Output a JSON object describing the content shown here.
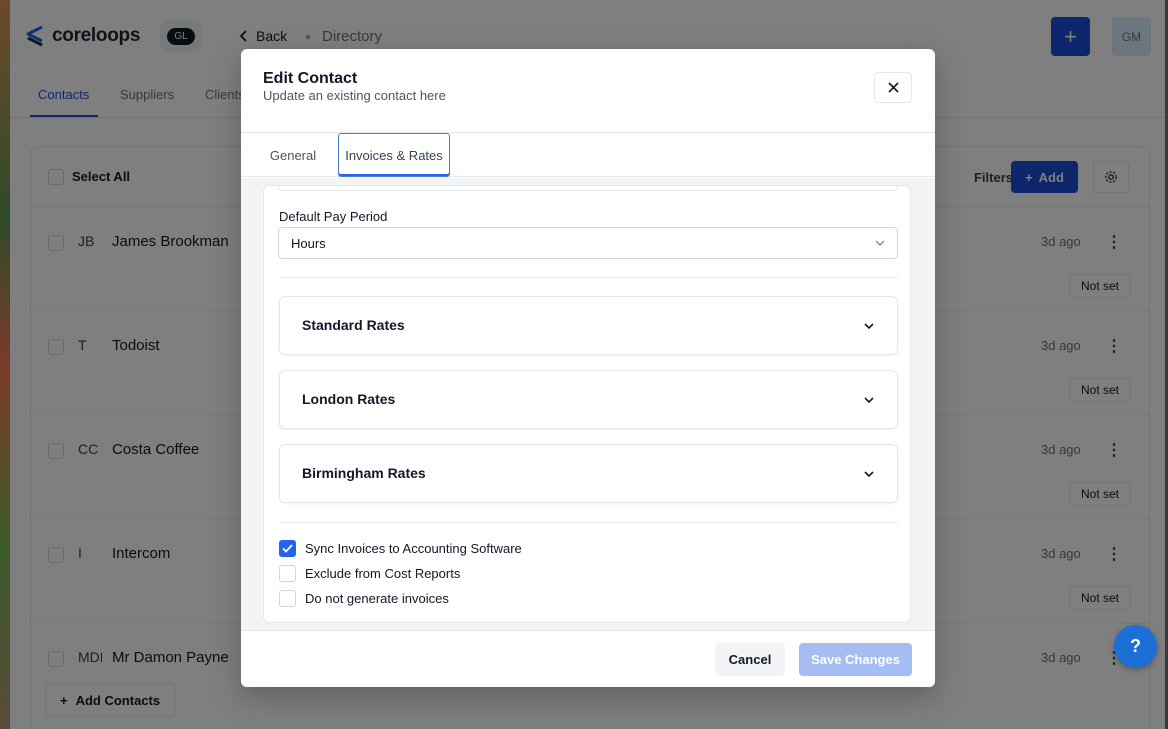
{
  "app": {
    "logo_text": "coreloops",
    "org_badge": "GL",
    "back_label": "Back",
    "breadcrumb": "Directory",
    "header_add_label": "+",
    "user_initials": "GM",
    "accent_color": "#1d4ed8"
  },
  "tabs": [
    "Contacts",
    "Suppliers",
    "Clients"
  ],
  "toolbar": {
    "select_all": "Select All",
    "filters": "Filters",
    "add": "Add"
  },
  "contacts": [
    {
      "initials": "JB",
      "name": "James Brookman",
      "updated": "3d ago",
      "status": "Not set"
    },
    {
      "initials": "T",
      "name": "Todoist",
      "updated": "3d ago",
      "status": "Not set"
    },
    {
      "initials": "CC",
      "name": "Costa Coffee",
      "updated": "3d ago",
      "status": "Not set"
    },
    {
      "initials": "I",
      "name": "Intercom",
      "updated": "3d ago",
      "status": "Not set"
    },
    {
      "initials": "MDP",
      "name": "Mr Damon Payne",
      "updated": "3d ago",
      "status": ""
    }
  ],
  "add_contacts": "Add Contacts",
  "help_label": "?",
  "modal": {
    "title": "Edit Contact",
    "subtitle": "Update an existing contact here",
    "tabs": {
      "general": "General",
      "invoices": "Invoices & Rates"
    },
    "pay_period": {
      "label": "Default Pay Period",
      "value": "Hours"
    },
    "rates": [
      "Standard Rates",
      "London Rates",
      "Birmingham Rates"
    ],
    "options": [
      {
        "label": "Sync Invoices to Accounting Software",
        "checked": true
      },
      {
        "label": "Exclude from Cost Reports",
        "checked": false
      },
      {
        "label": "Do not generate invoices",
        "checked": false
      }
    ],
    "cancel": "Cancel",
    "save": "Save Changes"
  }
}
